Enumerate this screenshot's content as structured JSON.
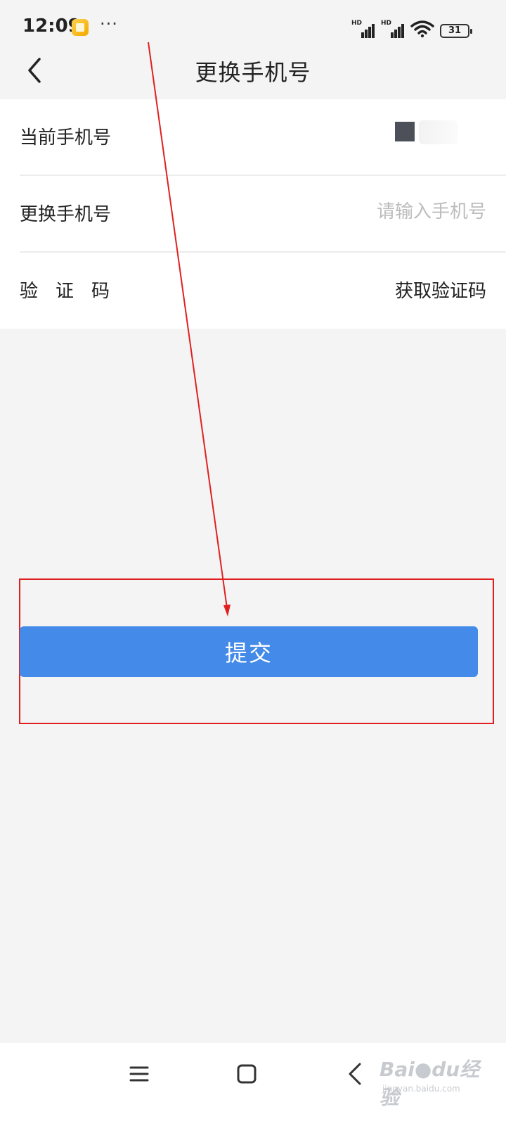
{
  "status_bar": {
    "time": "12:09",
    "more": "···",
    "signal_badge_1": "HD",
    "signal_badge_2": "HD",
    "battery": "31"
  },
  "nav": {
    "title": "更换手机号",
    "back_icon": "chevron-left-icon"
  },
  "form": {
    "current_phone_label": "当前手机号",
    "new_phone_label": "更换手机号",
    "new_phone_placeholder": "请输入手机号",
    "new_phone_value": "",
    "code_label": "验证码",
    "get_code_label": "获取验证码"
  },
  "actions": {
    "submit_label": "提交",
    "submit_color": "#448ae8"
  },
  "annotation": {
    "color": "#e02020"
  },
  "bottom_nav": {
    "icons": [
      "menu-icon",
      "home-icon",
      "back-icon"
    ]
  },
  "watermark": {
    "main": "Bai●du经验",
    "sub": "jingyan.baidu.com"
  }
}
